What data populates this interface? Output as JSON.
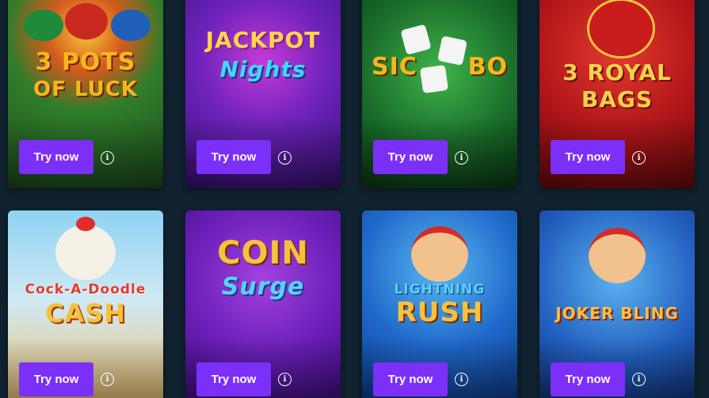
{
  "games": [
    {
      "title_line1": "3 POTS",
      "title_line2": "OF LUCK",
      "button": "Try now",
      "info_icon": "info-icon"
    },
    {
      "title_line1": "JACKPOT",
      "title_line2": "Nights",
      "button": "Try now",
      "info_icon": "info-icon"
    },
    {
      "title_line1": "SIC",
      "title_line2": "BO",
      "button": "Try now",
      "info_icon": "info-icon"
    },
    {
      "title_line1": "3 ROYAL",
      "title_line2": "BAGS",
      "button": "Try now",
      "info_icon": "info-icon"
    },
    {
      "title_line1": "Cock-A-Doodle",
      "title_line2": "CASH",
      "button": "Try now",
      "info_icon": "info-icon"
    },
    {
      "title_line1": "COIN",
      "title_line2": "Surge",
      "button": "Try now",
      "info_icon": "info-icon"
    },
    {
      "title_line1": "LIGHTNING",
      "title_line2": "RUSH",
      "button": "Try now",
      "info_icon": "info-icon"
    },
    {
      "title_line1": "JOKER BLING",
      "title_line2": "",
      "button": "Try now",
      "info_icon": "info-icon"
    }
  ],
  "colors": {
    "page_background": "#10212f",
    "button_background": "#7b2ff7",
    "button_text": "#ffffff"
  }
}
